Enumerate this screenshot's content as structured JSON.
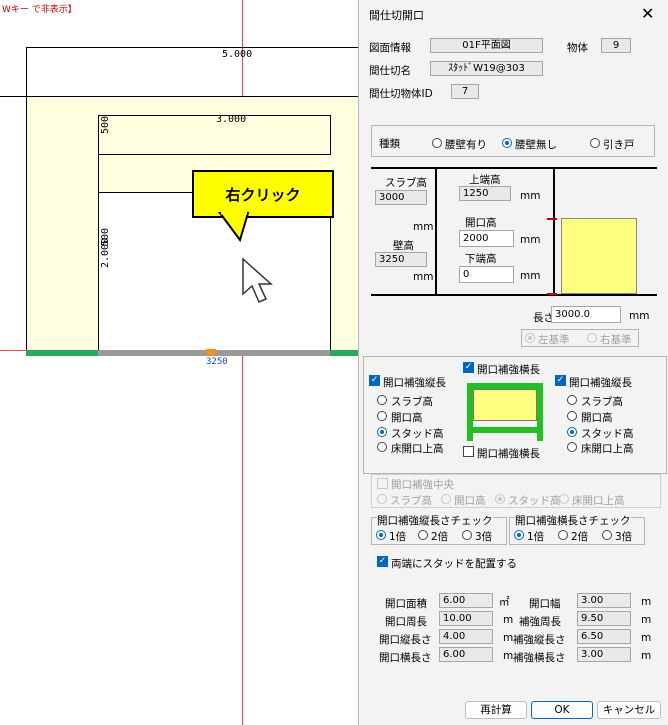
{
  "canvas": {
    "hint": "Wキー で非表示】",
    "dim_top": "5.000",
    "dim_inner": "3.000",
    "dim_left_small": "500",
    "dim_left_large": "2.000",
    "dim_left_mid": "500",
    "dim_bottom": "3250",
    "callout": "右クリック"
  },
  "dialog": {
    "title": "間仕切開口",
    "close": "✕",
    "info_label": "図面情報",
    "info_value": "01F平面図",
    "object_label": "物体",
    "object_value": "9",
    "partition_name_label": "間仕切名",
    "partition_name_value": "ｽﾀｯﾄﾞW19@303",
    "partition_id_label": "間仕切物体ID",
    "partition_id_value": "7",
    "kind_label": "種類",
    "kind_options": [
      "腰壁有り",
      "腰壁無し",
      "引き戸"
    ],
    "kind_selected": 1,
    "slab_label": "スラブ高",
    "slab_value": "3000",
    "mm": "mm",
    "wall_label": "壁高",
    "wall_value": "3250",
    "top_label": "上端高",
    "top_value": "1250",
    "open_label": "開口高",
    "open_value": "2000",
    "bottom_label": "下端高",
    "bottom_value": "0",
    "length_label": "長さ",
    "length_value": "3000.0",
    "base_left": "左基準",
    "base_right": "右基準",
    "left_vert_label": "開口補強縦長",
    "right_vert_label": "開口補強縦長",
    "top_horiz_label": "開口補強横長",
    "bottom_horiz_label": "開口補強横長",
    "height_options": [
      "スラブ高",
      "開口高",
      "スタッド高",
      "床開口上高"
    ],
    "center_label": "開口補強中央",
    "center_options": [
      "スラブ高",
      "開口高",
      "スタッド高",
      "床開口上高"
    ],
    "vert_check_label": "開口補強縦長さチェック",
    "horiz_check_label": "開口補強横長さチェック",
    "multiples": [
      "1倍",
      "2倍",
      "3倍"
    ],
    "both_ends_label": "両端にスタッドを配置する",
    "area_label": "開口面積",
    "area_value": "6.00",
    "area_unit": "㎡",
    "width_label": "開口幅",
    "width_value": "3.00",
    "perimeter_label": "開口周長",
    "perimeter_value": "10.00",
    "reinf_perimeter_label": "補強周長",
    "reinf_perimeter_value": "9.50",
    "open_vert_label": "開口縦長さ",
    "open_vert_value": "4.00",
    "reinf_vert_label": "補強縦長さ",
    "reinf_vert_value": "6.50",
    "open_horiz_label": "開口横長さ",
    "open_horiz_value": "6.00",
    "reinf_horiz_label": "補強横長さ",
    "reinf_horiz_value": "3.00",
    "m": "m",
    "recalc": "再計算",
    "ok": "OK",
    "cancel": "キャンセル"
  }
}
